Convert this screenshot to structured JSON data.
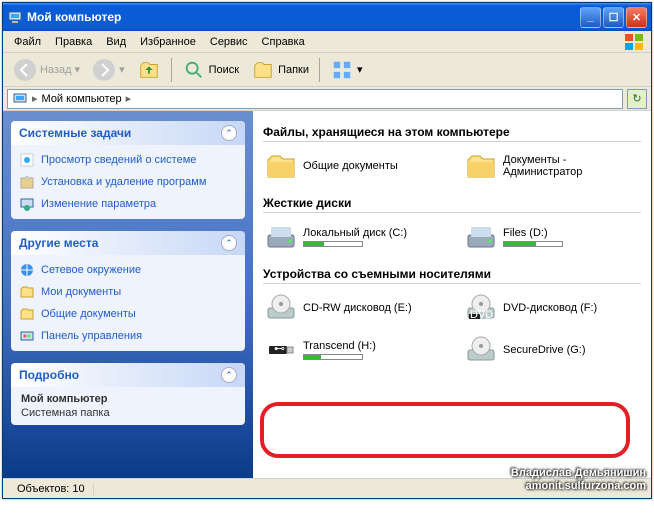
{
  "window": {
    "title": "Мой компьютер"
  },
  "menu": {
    "file": "Файл",
    "edit": "Правка",
    "view": "Вид",
    "favorites": "Избранное",
    "tools": "Сервис",
    "help": "Справка"
  },
  "toolbar": {
    "back": "Назад",
    "search": "Поиск",
    "folders": "Папки"
  },
  "address": {
    "path": "Мой компьютер"
  },
  "panels": {
    "tasks": {
      "title": "Системные задачи",
      "items": [
        "Просмотр сведений о системе",
        "Установка и удаление программ",
        "Изменение параметра"
      ]
    },
    "places": {
      "title": "Другие места",
      "items": [
        "Сетевое окружение",
        "Мои документы",
        "Общие документы",
        "Панель управления"
      ]
    },
    "details": {
      "title": "Подробно",
      "name": "Мой компьютер",
      "type": "Системная папка"
    }
  },
  "sections": {
    "files_header": "Файлы, хранящиеся на этом компьютере",
    "files": [
      {
        "label": "Общие документы"
      },
      {
        "label": "Документы - Администратор"
      }
    ],
    "disks_header": "Жесткие диски",
    "disks": [
      {
        "label": "Локальный диск (C:)",
        "fill": 35
      },
      {
        "label": "Files (D:)",
        "fill": 55
      }
    ],
    "removable_header": "Устройства со съемными носителями",
    "removable": [
      {
        "label": "CD-RW дисковод (E:)"
      },
      {
        "label": "DVD-дисковод (F:)"
      },
      {
        "label": "Transcend (H:)",
        "fill": 30
      },
      {
        "label": "SecureDrive (G:)"
      }
    ]
  },
  "status": {
    "objects_label": "Объектов:",
    "objects_count": "10"
  },
  "watermark": {
    "line1": "Владислав Демьянишин",
    "line2": "amonit.sulfurzona.com"
  }
}
